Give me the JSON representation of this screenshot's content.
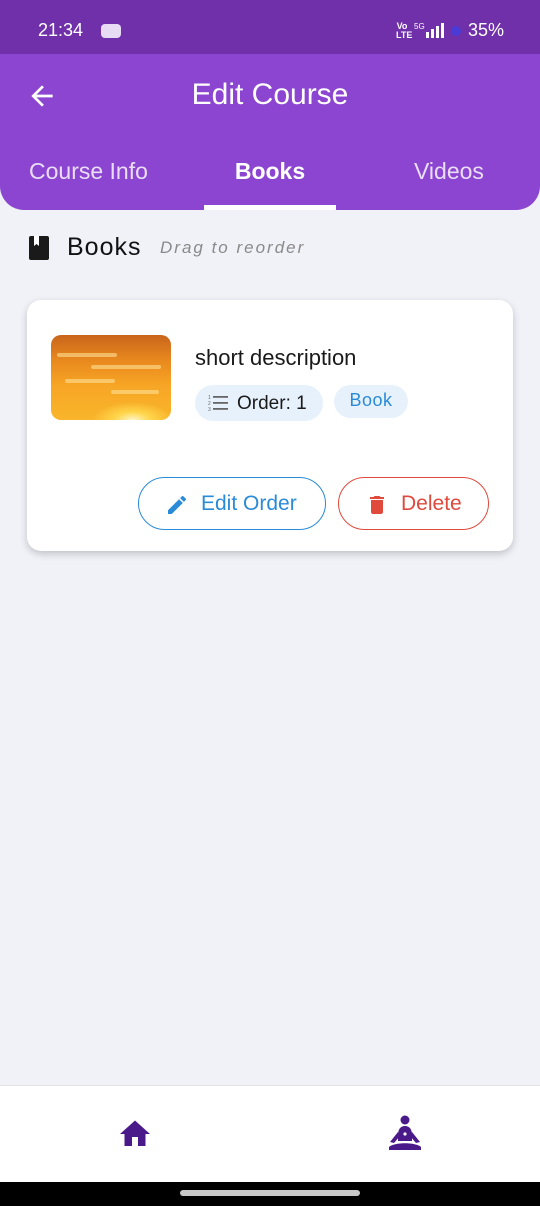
{
  "status_bar": {
    "time": "21:34",
    "network_label": "Vo LTE",
    "battery": "35%"
  },
  "header": {
    "title": "Edit Course",
    "back_icon": "arrow-left-icon"
  },
  "tabs": [
    {
      "label": "Course Info",
      "selected": false
    },
    {
      "label": "Books",
      "selected": true
    },
    {
      "label": "Videos",
      "selected": false
    }
  ],
  "section": {
    "icon": "book-icon",
    "title": "Books",
    "hint": "Drag to reorder"
  },
  "books": [
    {
      "description": "short description",
      "order_label": "Order: 1",
      "type_badge": "Book",
      "edit_button_label": "Edit Order",
      "delete_button_label": "Delete"
    }
  ],
  "bottom_nav": {
    "items": [
      {
        "icon": "home-icon"
      },
      {
        "icon": "meditation-icon"
      }
    ]
  },
  "colors": {
    "header_purple": "#8c45d0",
    "status_bar_purple": "#6f30a9",
    "accent_blue": "#2a8bd8",
    "danger_red": "#e04a3d",
    "nav_icon_purple": "#4b1a8a"
  }
}
